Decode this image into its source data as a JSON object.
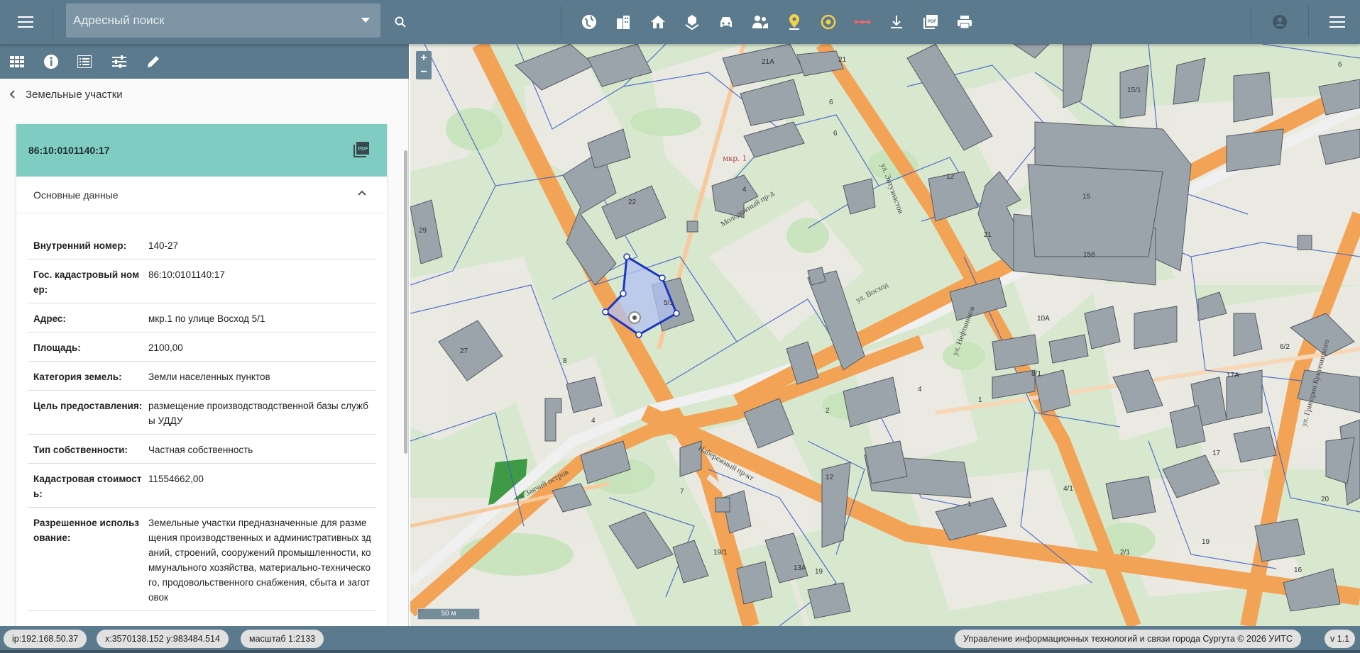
{
  "header": {
    "search": {
      "placeholder": "Адресный поиск"
    },
    "tools": [
      "globe-icon",
      "buildings-icon",
      "home-icon",
      "parcel-icon",
      "car-icon",
      "people-icon",
      "pin-icon",
      "target-icon",
      "measure-icon",
      "download-icon",
      "pdf-icon",
      "print-icon"
    ]
  },
  "panel": {
    "tabs": [
      "grid-icon",
      "info-icon",
      "list-icon",
      "sliders-icon",
      "edit-icon"
    ],
    "back_label": "Земельные участки",
    "card": {
      "title": "86:10:0101140:17",
      "section_title": "Основные данные",
      "rows": [
        {
          "k": "Внутренний номер:",
          "v": "140-27"
        },
        {
          "k": "Гос. кадастровый номер:",
          "v": "86:10:0101140:17"
        },
        {
          "k": "Адрес:",
          "v": "мкр.1 по улице Восход 5/1"
        },
        {
          "k": "Площадь:",
          "v": "2100,00"
        },
        {
          "k": "Категория земель:",
          "v": "Земли населенных пунктов"
        },
        {
          "k": "Цель предоставления:",
          "v": "размещение производстводственной базы службы УДДУ"
        },
        {
          "k": "Тип собственности:",
          "v": "Частная собственность"
        },
        {
          "k": "Кадастровая стоимость:",
          "v": "11554662,00"
        },
        {
          "k": "Разрешенное использование:",
          "v": "Земельные участки предназначенные для размещения производственных и административных зданий, строений, сооружений промышленности, коммунального хозяйства, материально-технического, продовольственного снабжения, сбыта и заготовок"
        }
      ]
    }
  },
  "map": {
    "zoom_in": "+",
    "zoom_out": "−",
    "scale_label": "50 м",
    "labels": {
      "district": "мкр. 1",
      "street_entuziastov": "ул. Энтузиастов",
      "street_voskhod": "ул. Восход",
      "street_molodezhny": "Молодежный пр-д",
      "street_naberezhny": "Набережный пр-кт",
      "street_zaychiy": "ул. Заячий остров",
      "street_neftyanikov": "ул. Нефтяников",
      "street_kukuyevitskogo": "ул. Григория Кукуевицкого",
      "bld_21a": "21А",
      "bld_21": "21",
      "bld_6a": "6",
      "bld_6b": "6",
      "bld_6c": "6",
      "bld_4": "4",
      "bld_22": "22",
      "bld_12": "12",
      "bld_21b": "21",
      "bld_15": "15",
      "bld_15b": "15б",
      "bld_15_1": "15/1",
      "bld_27": "27",
      "bld_29": "29",
      "bld_5_1": "5/1",
      "bld_1": "1",
      "bld_2": "2",
      "bld_4b": "4",
      "bld_12b": "12",
      "bld_10a": "10А",
      "bld_8_1": "8/1",
      "bld_17": "17",
      "bld_19": "19",
      "bld_16": "16",
      "bld_20": "20",
      "bld_19_1": "19/1",
      "bld_7": "7",
      "bld_8": "8",
      "bld_4c": "4",
      "bld_2_1": "2/1",
      "bld_13a": "13А",
      "bld_17a": "17А",
      "bld_4_1": "4/1",
      "bld_19b": "19",
      "bld_1b": "1",
      "bld_6_2": "6/2"
    },
    "colors": {
      "background": "#d7e8cf",
      "road": "#f3a356",
      "parcel": "#3c5fd0",
      "building": "#9aa3ab"
    }
  },
  "status": {
    "ip": "ip:192.168.50.37",
    "coords": "x:3570138.152 y:983484.514",
    "scale": "масштаб 1:2133",
    "copyright": "Управление информационных технологий и связи города Сургута © 2026 УИТС",
    "version": "v 1.1"
  }
}
